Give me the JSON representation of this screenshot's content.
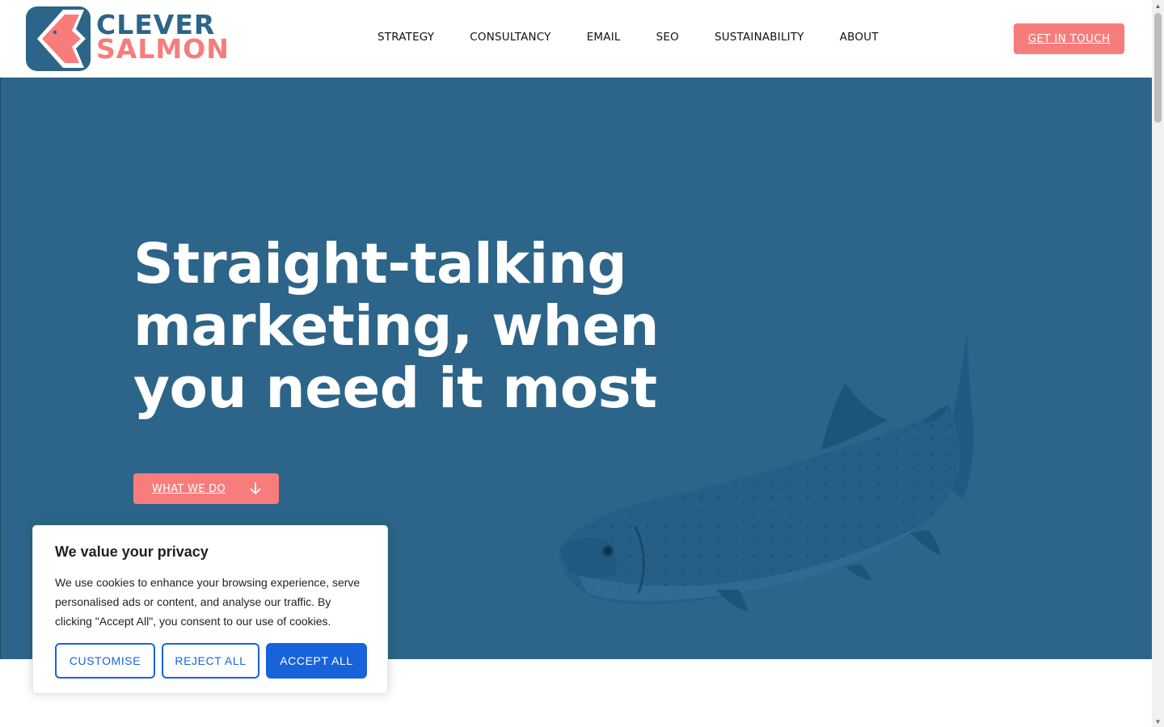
{
  "header": {
    "logo": {
      "line1": "CLEVER",
      "line2": "SALMON"
    },
    "nav": [
      {
        "label": "STRATEGY"
      },
      {
        "label": "CONSULTANCY"
      },
      {
        "label": "EMAIL"
      },
      {
        "label": "SEO"
      },
      {
        "label": "SUSTAINABILITY"
      },
      {
        "label": "ABOUT"
      }
    ],
    "cta_label": "GET IN TOUCH"
  },
  "hero": {
    "title_line1": "Straight-talking",
    "title_line2": "marketing, when",
    "title_line3": "you need it most",
    "button_label": "WHAT WE DO",
    "button_icon": "arrow-down-icon",
    "image": "salmon-fish-image"
  },
  "cookie_banner": {
    "title": "We value your privacy",
    "text": "We use cookies to enhance your browsing experience, serve personalised ads or content, and analyse our traffic. By clicking \"Accept All\", you consent to our use of cookies.",
    "customise_label": "CUSTOMISE",
    "reject_label": "REJECT ALL",
    "accept_label": "ACCEPT ALL"
  },
  "colors": {
    "brand_blue": "#2c6589",
    "brand_coral": "#f87c7c",
    "consent_blue": "#1863dc",
    "text_dark": "#111111"
  }
}
